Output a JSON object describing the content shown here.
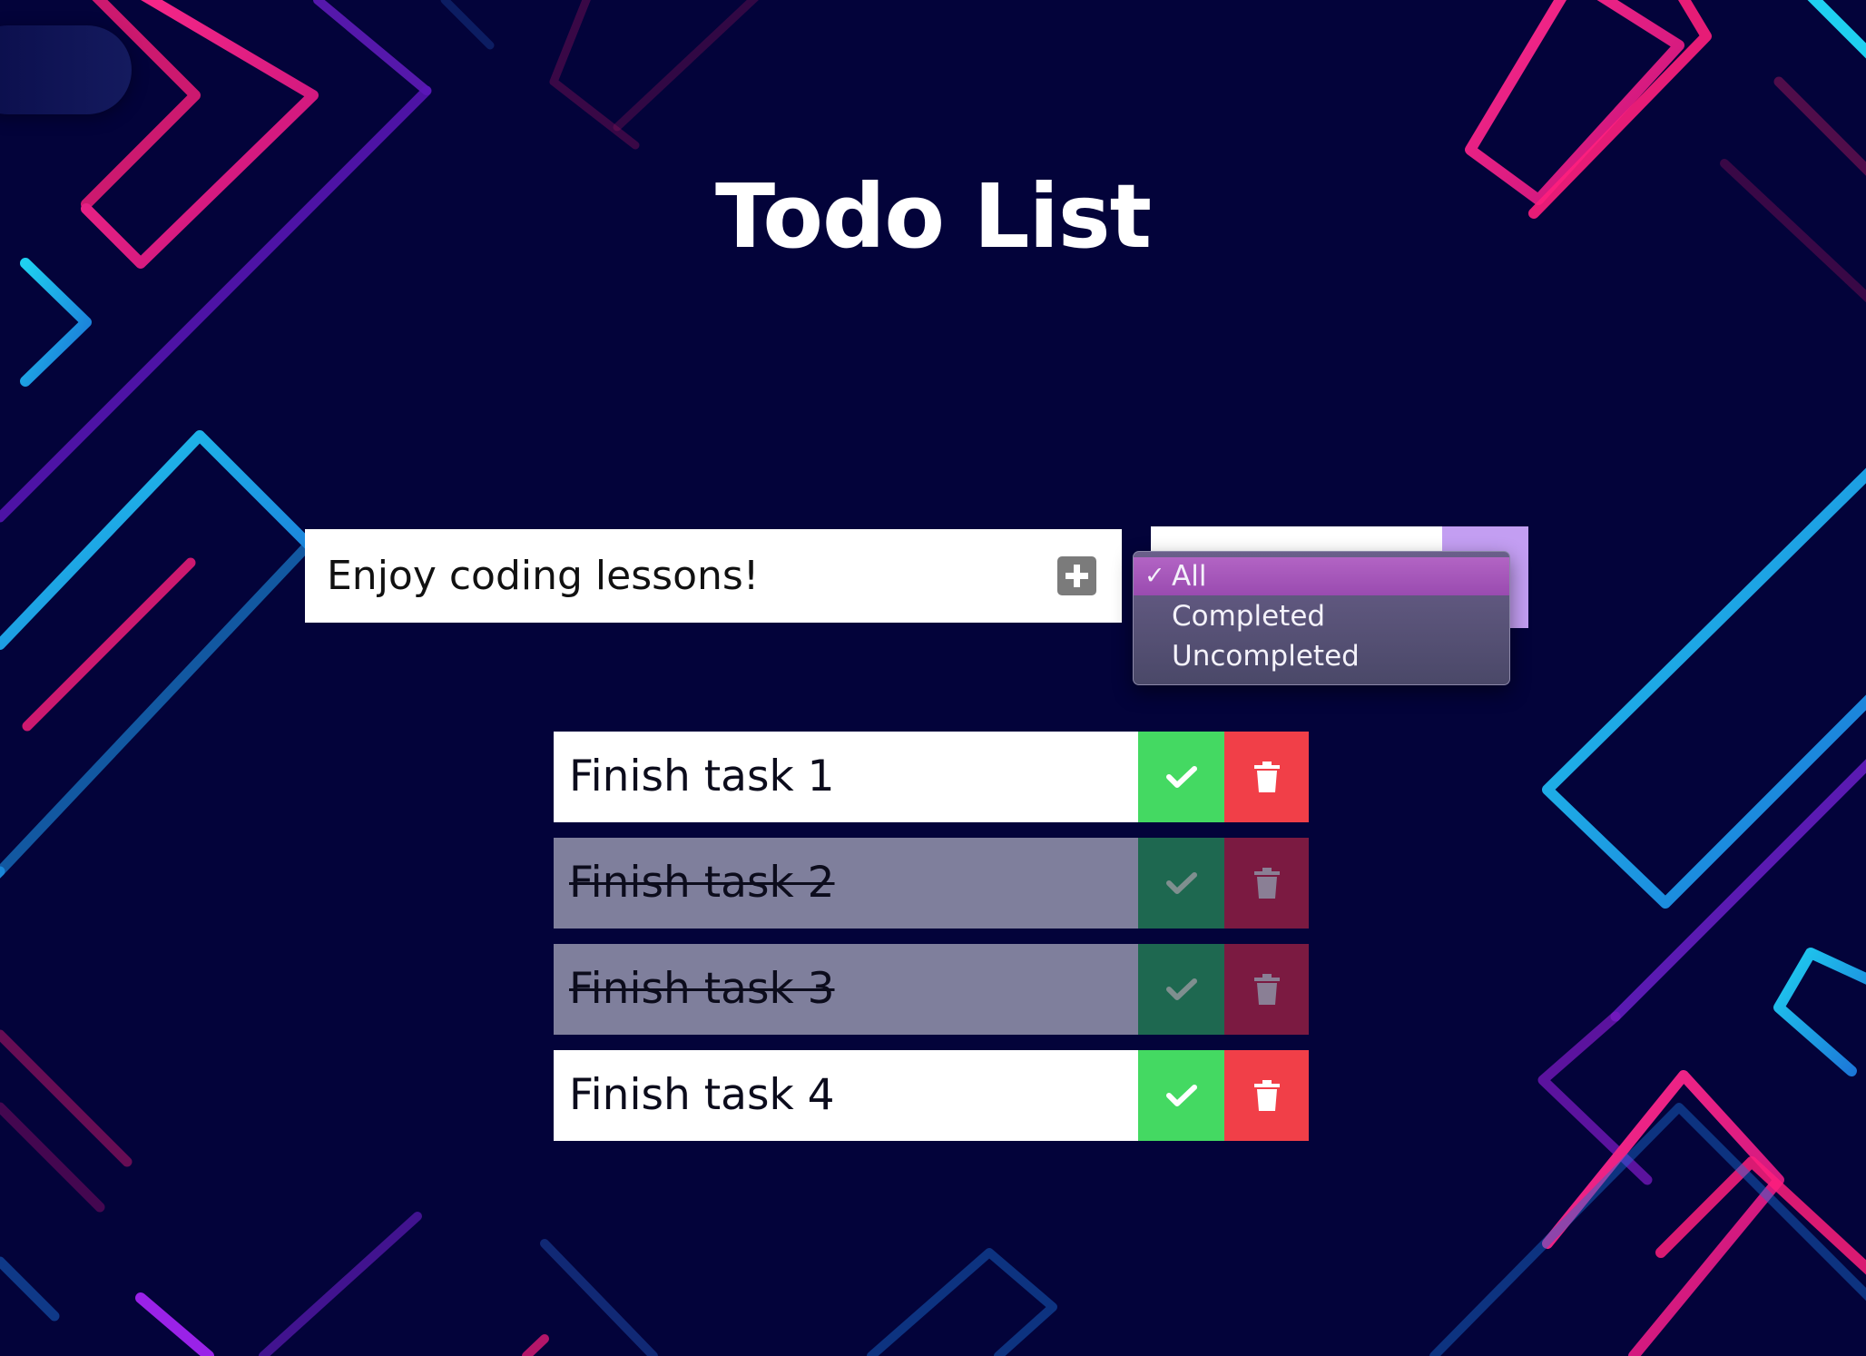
{
  "app": {
    "title": "Todo List"
  },
  "new_todo": {
    "value": "Enjoy coding lessons!"
  },
  "filter": {
    "selected": "All",
    "options": [
      {
        "label": "All",
        "selected": true
      },
      {
        "label": "Completed",
        "selected": false
      },
      {
        "label": "Uncompleted",
        "selected": false
      }
    ]
  },
  "todos": [
    {
      "text": "Finish task 1",
      "completed": false
    },
    {
      "text": "Finish task 2",
      "completed": true
    },
    {
      "text": "Finish task 3",
      "completed": true
    },
    {
      "text": "Finish task 4",
      "completed": false
    }
  ],
  "icons": {
    "add": "plus-square-icon",
    "complete": "check-icon",
    "delete": "trash-icon",
    "selected_option": "checkmark-icon"
  },
  "colors": {
    "background": "#03033a",
    "complete_button": "#44d962",
    "delete_button": "#f13f48",
    "completed_row": "#7f7f9c",
    "select_arrow": "#c39ef2",
    "dropdown_highlight": "#a553ba"
  }
}
